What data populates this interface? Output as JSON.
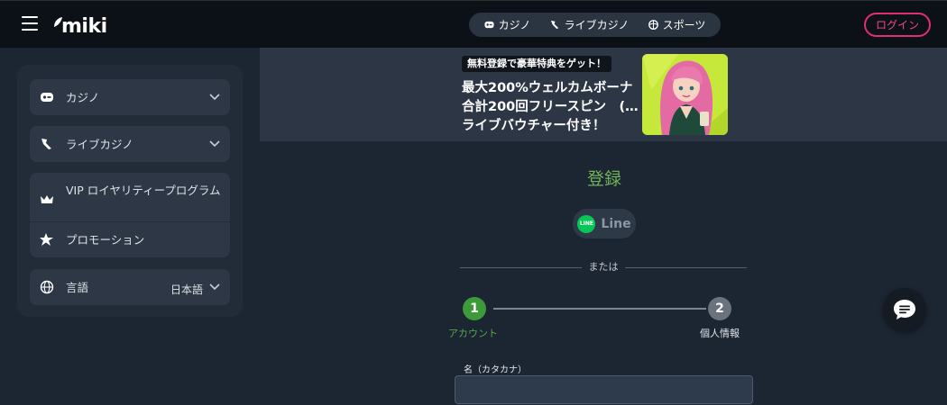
{
  "header": {
    "logo_text": "miki",
    "nav": [
      {
        "label": "カジノ",
        "icon": "casino-icon"
      },
      {
        "label": "ライブカジノ",
        "icon": "live-casino-icon"
      },
      {
        "label": "スポーツ",
        "icon": "sports-icon"
      }
    ],
    "login_label": "ログイン"
  },
  "sidebar": {
    "items": [
      {
        "label": "カジノ",
        "icon": "casino-icon"
      },
      {
        "label": "ライブカジノ",
        "icon": "live-casino-icon"
      },
      {
        "label": "VIP ロイヤリティープログラム",
        "icon": "crown-icon"
      },
      {
        "label": "プロモーション",
        "icon": "star-icon"
      }
    ],
    "language": {
      "label": "言語",
      "value": "日本語",
      "icon": "globe-icon"
    }
  },
  "banner": {
    "tag": "無料登録で豪華特典をゲット！",
    "line1": "最大200%ウェルカムボーナ",
    "line2": "合計200回フリースピン　(…",
    "line3": "ライブバウチャー付き！"
  },
  "register": {
    "title": "登録",
    "line_badge": "LINE",
    "line_label": "Line",
    "or_text": "または",
    "steps": [
      {
        "number": "1",
        "label": "アカウント"
      },
      {
        "number": "2",
        "label": "個人情報"
      }
    ],
    "field_label": "名（カタカナ）",
    "field_value": ""
  },
  "colors": {
    "accent_green": "#6fb45a",
    "login_pink": "#e0306e",
    "background": "#1c2532"
  }
}
